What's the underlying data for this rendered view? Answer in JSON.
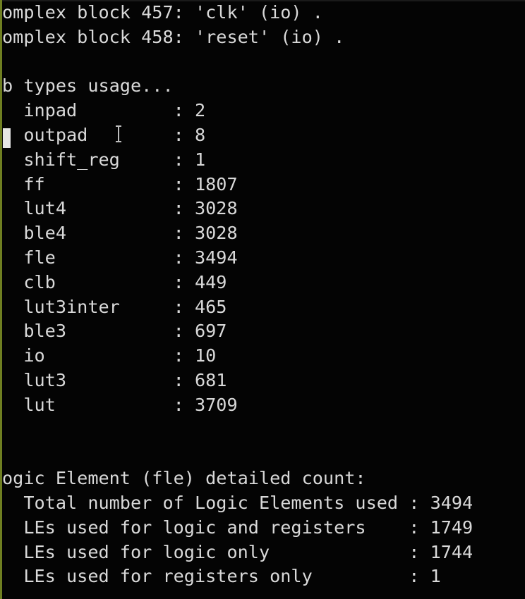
{
  "terminal": {
    "lines": [
      "omplex block 457: 'clk' (io) .",
      "omplex block 458: 'reset' (io) .",
      "",
      "b types usage...",
      "  inpad         : 2",
      "  outpad        : 8",
      "  shift_reg     : 1",
      "  ff            : 1807",
      "  lut4          : 3028",
      "  ble4          : 3028",
      "  fle           : 3494",
      "  clb           : 449",
      "  lut3inter     : 465",
      "  ble3          : 697",
      "  io            : 10",
      "  lut3          : 681",
      "  lut           : 3709",
      "",
      "",
      "ogic Element (fle) detailed count:",
      "  Total number of Logic Elements used : 3494",
      "  LEs used for logic and registers    : 1749",
      "  LEs used for logic only             : 1744",
      "  LEs used for registers only         : 1"
    ]
  },
  "colors": {
    "background": "#040404",
    "text": "#d9d9d9",
    "left_stripe": "#6f7f21"
  },
  "icons": {
    "cursor": "text-cursor-block",
    "mouse_pointer": "ibeam-icon"
  }
}
